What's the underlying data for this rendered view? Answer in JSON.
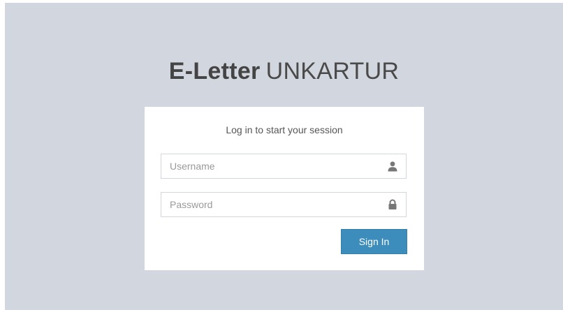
{
  "logo": {
    "bold": "E-Letter",
    "light": "UNKARTUR"
  },
  "login": {
    "message": "Log in to start your session",
    "username_placeholder": "Username",
    "password_placeholder": "Password",
    "signin_label": "Sign In"
  },
  "colors": {
    "page_background": "#d2d6de",
    "box_background": "#ffffff",
    "button_primary": "#3c8dbc",
    "icon": "#777777"
  },
  "icons": {
    "username": "user-icon",
    "password": "lock-icon"
  }
}
